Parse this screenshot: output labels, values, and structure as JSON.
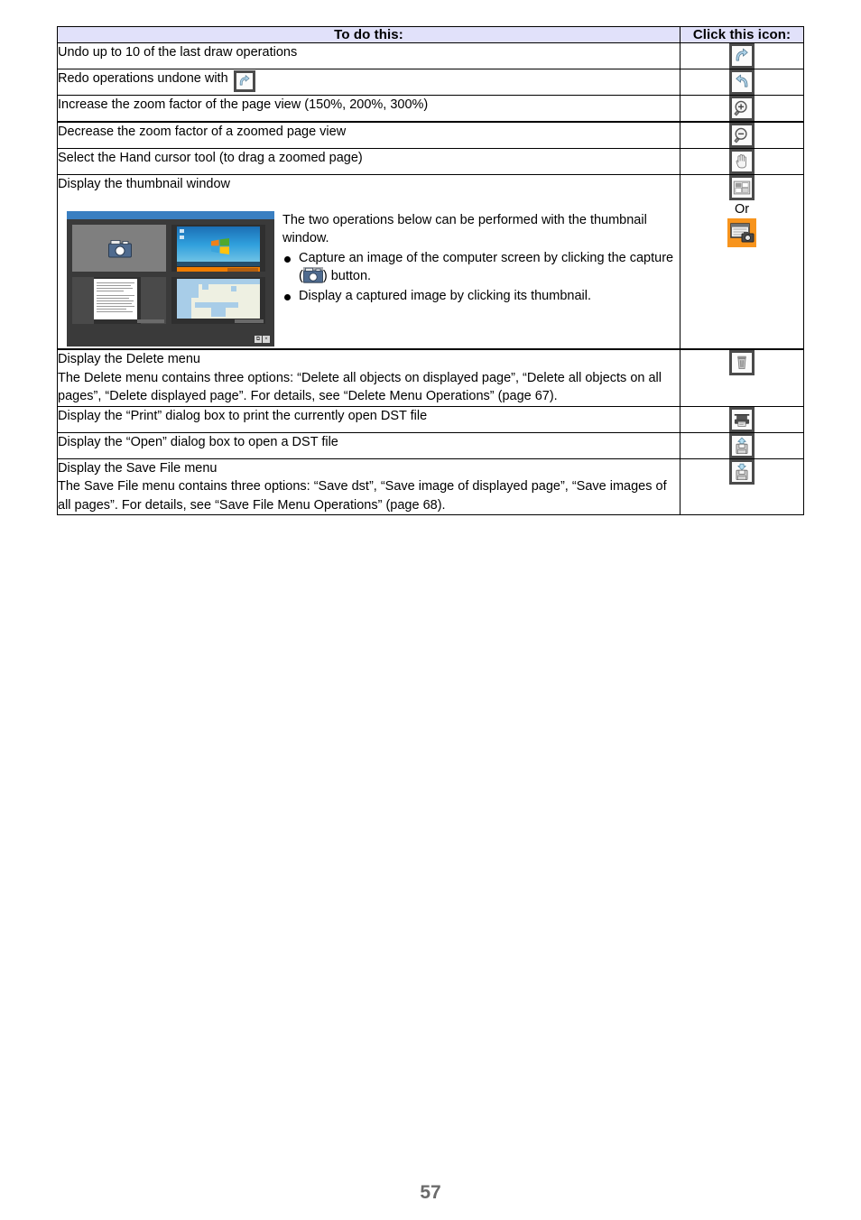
{
  "table": {
    "headers": {
      "desc": "To do this:",
      "icon": "Click this icon:"
    },
    "header_bg": "#e1e1fa",
    "rows": [
      {
        "desc": "Undo up to 10 of the last draw operations",
        "icon_name": "undo-icon"
      },
      {
        "desc_prefix": "Redo operations undone with",
        "inline_icon": "undo-icon",
        "icon_name": "redo-icon"
      },
      {
        "desc": "Increase the zoom factor of the page view (150%, 200%, 300%)",
        "icon_name": "zoom-in-icon"
      },
      {
        "desc": "Decrease the zoom factor of a zoomed page view",
        "icon_name": "zoom-out-icon"
      },
      {
        "desc": "Select the Hand cursor tool (to drag a zoomed page)",
        "icon_name": "hand-cursor-icon"
      },
      {
        "title": "Display the thumbnail window",
        "lead": "The two operations below can be performed with the thumbnail window.",
        "bullets": [
          {
            "before": "Capture an image of the computer screen by clicking the capture (",
            "inline_icon": "camera-icon",
            "after": ") button."
          },
          {
            "text": "Display a captured image by clicking its thumbnail."
          }
        ],
        "icon_name": "thumbnail-grid-icon",
        "or_label": "Or",
        "icon_name_alt": "capture-window-icon",
        "alt_icon_bg": "#f7941d"
      },
      {
        "title": "Display the Delete menu",
        "body": "The Delete menu contains three options: “Delete all objects on displayed page”, “Delete all objects on all pages”, “Delete displayed page”. For details, see “Delete Menu Operations” (page 67).",
        "icon_name": "trash-icon"
      },
      {
        "desc": "Display the “Print” dialog box to print the currently open DST file",
        "icon_name": "print-icon"
      },
      {
        "desc": "Display the “Open” dialog box to open a DST file",
        "icon_name": "open-file-icon"
      },
      {
        "title": "Display the Save File menu",
        "body": "The Save File menu contains three options: “Save dst”, “Save image of displayed page”, “Save images of all pages”. For details, see “Save File Menu Operations” (page 68).",
        "icon_name": "save-file-icon"
      }
    ]
  },
  "footer": {
    "page_number": "57"
  }
}
